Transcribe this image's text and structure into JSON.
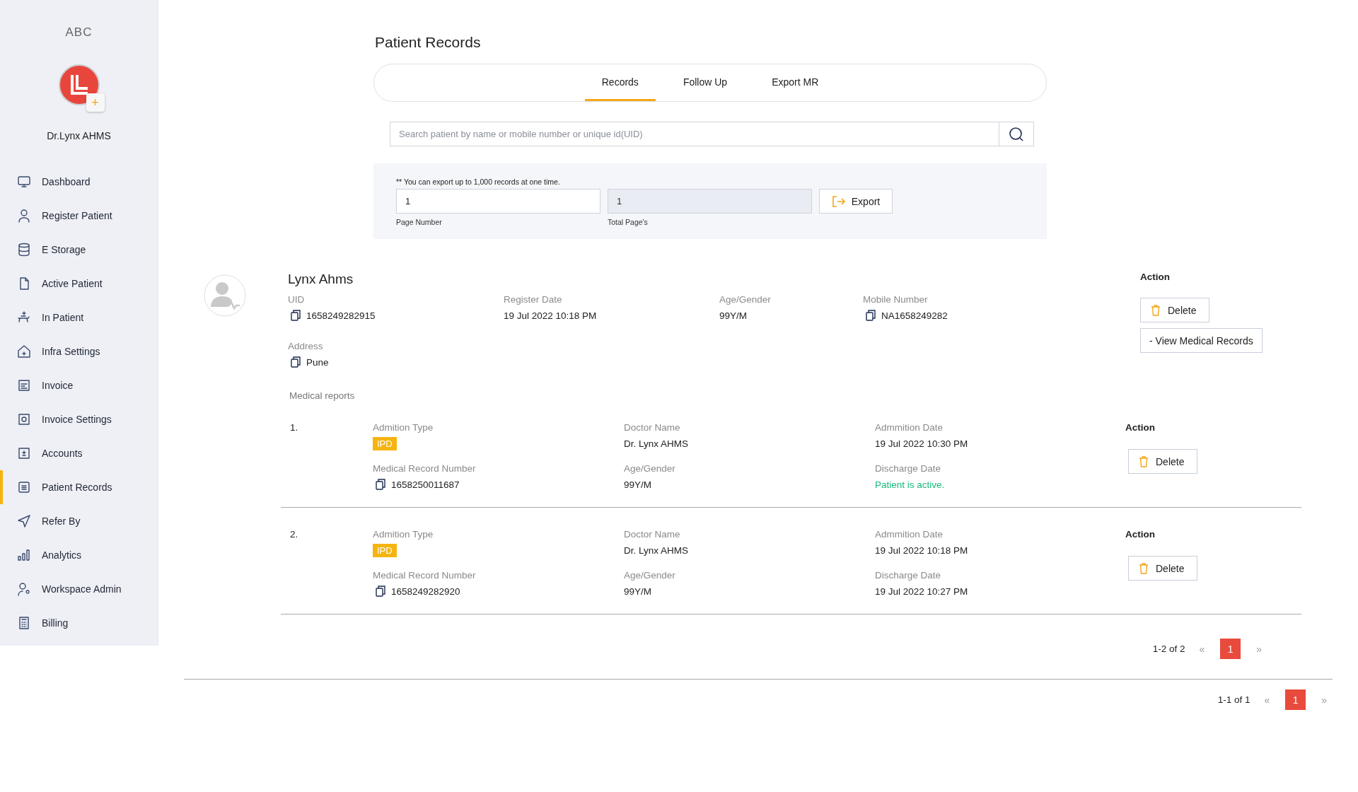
{
  "sidebar": {
    "brand": "ABC",
    "user_name": "Dr.Lynx AHMS",
    "add_symbol": "+",
    "items": [
      {
        "label": "Dashboard",
        "selected": false
      },
      {
        "label": "Register Patient",
        "selected": false
      },
      {
        "label": "E Storage",
        "selected": false
      },
      {
        "label": "Active Patient",
        "selected": false
      },
      {
        "label": "In Patient",
        "selected": false
      },
      {
        "label": "Infra Settings",
        "selected": false
      },
      {
        "label": "Invoice",
        "selected": false
      },
      {
        "label": "Invoice Settings",
        "selected": false
      },
      {
        "label": "Accounts",
        "selected": false
      },
      {
        "label": "Patient Records",
        "selected": true
      },
      {
        "label": "Refer By",
        "selected": false
      },
      {
        "label": "Analytics",
        "selected": false
      },
      {
        "label": "Workspace Admin",
        "selected": false
      },
      {
        "label": "Billing",
        "selected": false
      }
    ]
  },
  "page_title": "Patient Records",
  "tabs": [
    {
      "label": "Records",
      "selected": true
    },
    {
      "label": "Follow Up",
      "selected": false
    },
    {
      "label": "Export MR",
      "selected": false
    }
  ],
  "search": {
    "placeholder": "Search patient by name or mobile number or unique id(UID)"
  },
  "export": {
    "note": "** You can export up to 1,000 records at one time.",
    "page_number": {
      "value": "1",
      "label": "Page Number"
    },
    "total_pages": {
      "value": "1",
      "label": "Total Page's",
      "disabled": true
    },
    "button": "Export"
  },
  "patient": {
    "name": "Lynx Ahms",
    "fields": [
      {
        "label": "UID",
        "value": "1658249282915",
        "kind": "copy"
      },
      {
        "label": "Register Date",
        "value": "19 Jul 2022 10:18 PM",
        "kind": "text"
      },
      {
        "label": "Age/Gender",
        "value": "99Y/M",
        "kind": "text"
      },
      {
        "label": "Mobile Number",
        "value": "NA1658249282",
        "kind": "copy"
      },
      {
        "label": "Address",
        "value": "Pune",
        "kind": "copy"
      }
    ],
    "action_label": "Action",
    "delete_button": "Delete",
    "view_button": "- View Medical Records"
  },
  "medical_reports": {
    "title": "Medical reports",
    "reports": [
      {
        "number": "1.",
        "action_label": "Action",
        "delete_button": "Delete",
        "fields": [
          {
            "label": "Admition Type",
            "value": "IPD",
            "kind": "badge"
          },
          {
            "label": "Doctor Name",
            "value": "Dr. Lynx AHMS",
            "kind": "text"
          },
          {
            "label": "Admmition Date",
            "value": "19 Jul 2022 10:30 PM",
            "kind": "text"
          },
          {
            "label": "Medical Record Number",
            "value": "1658250011687",
            "kind": "copy"
          },
          {
            "label": "Age/Gender",
            "value": "99Y/M",
            "kind": "text"
          },
          {
            "label": "Discharge Date",
            "value": "Patient is active.",
            "kind": "status"
          }
        ]
      },
      {
        "number": "2.",
        "action_label": "Action",
        "delete_button": "Delete",
        "fields": [
          {
            "label": "Admition Type",
            "value": "IPD",
            "kind": "badge"
          },
          {
            "label": "Doctor Name",
            "value": "Dr. Lynx AHMS",
            "kind": "text"
          },
          {
            "label": "Admmition Date",
            "value": "19 Jul 2022 10:18 PM",
            "kind": "text"
          },
          {
            "label": "Medical Record Number",
            "value": "1658249282920",
            "kind": "copy"
          },
          {
            "label": "Age/Gender",
            "value": "99Y/M",
            "kind": "text"
          },
          {
            "label": "Discharge Date",
            "value": "19 Jul 2022 10:27 PM",
            "kind": "text"
          }
        ]
      }
    ],
    "pagination": {
      "summary": "1-2 of 2",
      "prev": "«",
      "pages": [
        {
          "label": "1",
          "selected": true
        }
      ],
      "next": "»"
    }
  },
  "pagination": {
    "summary": "1-1 of 1",
    "prev": "«",
    "pages": [
      {
        "label": "1",
        "selected": true
      }
    ],
    "next": "»"
  }
}
